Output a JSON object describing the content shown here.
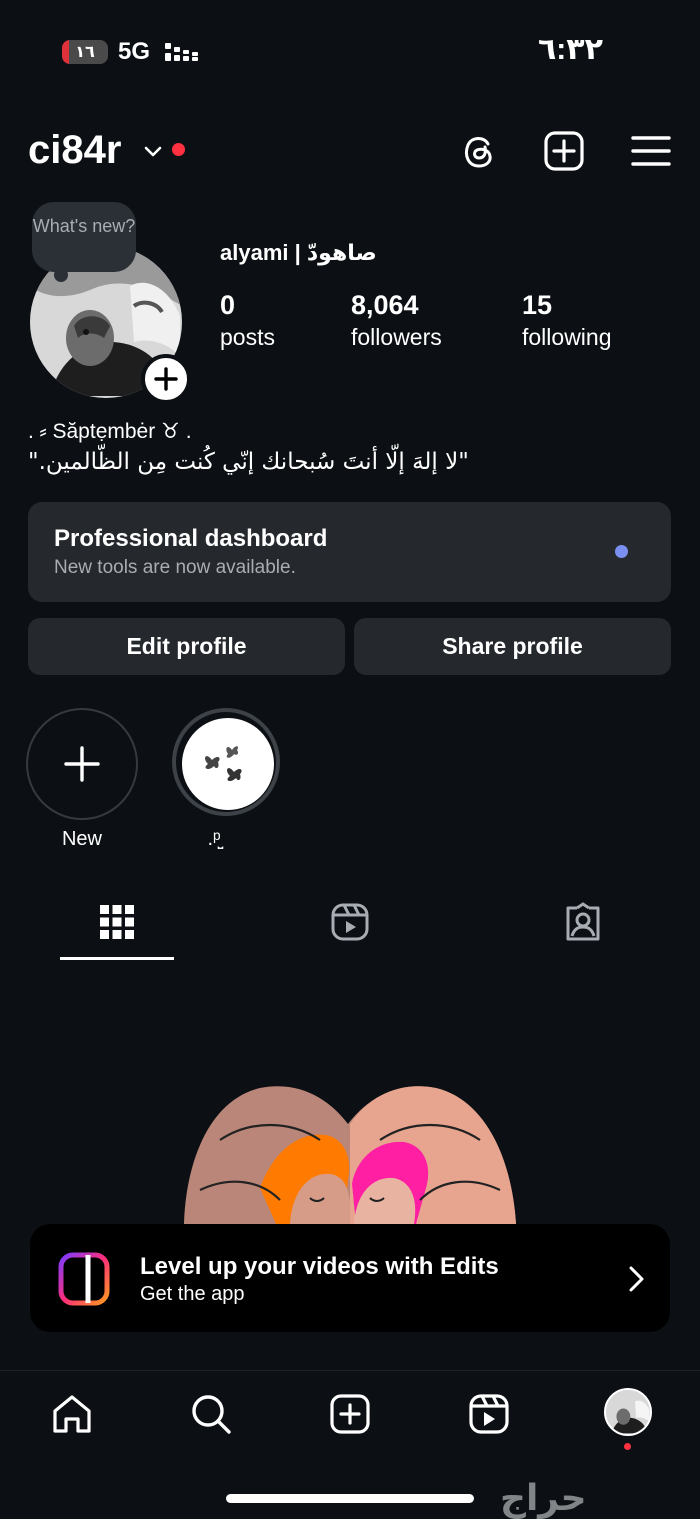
{
  "status_bar": {
    "battery": "١٦",
    "battery_level": 0.16,
    "network": "5G",
    "time": "٦:٣٢"
  },
  "header": {
    "username": "ci84r"
  },
  "profile": {
    "note": "What's new?",
    "display_name": "alyami | صاهودّ",
    "stats": [
      {
        "value": "0",
        "label": "posts"
      },
      {
        "value": "8,064",
        "label": "followers"
      },
      {
        "value": "15",
        "label": "following"
      }
    ],
    "bio_line1": ". ⸗ Săptẹmbėr ♉︎ .",
    "bio_line2": "\"لا إلهَ إلّا أنتَ سُبحانك إنّي كُنت مِن الظّالمين.\""
  },
  "dashboard": {
    "title": "Professional dashboard",
    "subtitle": "New tools are now available."
  },
  "actions": {
    "edit": "Edit profile",
    "share": "Share profile"
  },
  "highlights": [
    {
      "label": "New"
    },
    {
      "label": ".ᵖ̤̮"
    }
  ],
  "banner": {
    "title": "Level up your videos with Edits",
    "subtitle": "Get the app"
  },
  "watermark": "حراج",
  "colors": {
    "background": "#0c1014",
    "card": "#25292e",
    "notification_red": "#ff3040",
    "dashboard_dot": "#7b8ff0"
  }
}
